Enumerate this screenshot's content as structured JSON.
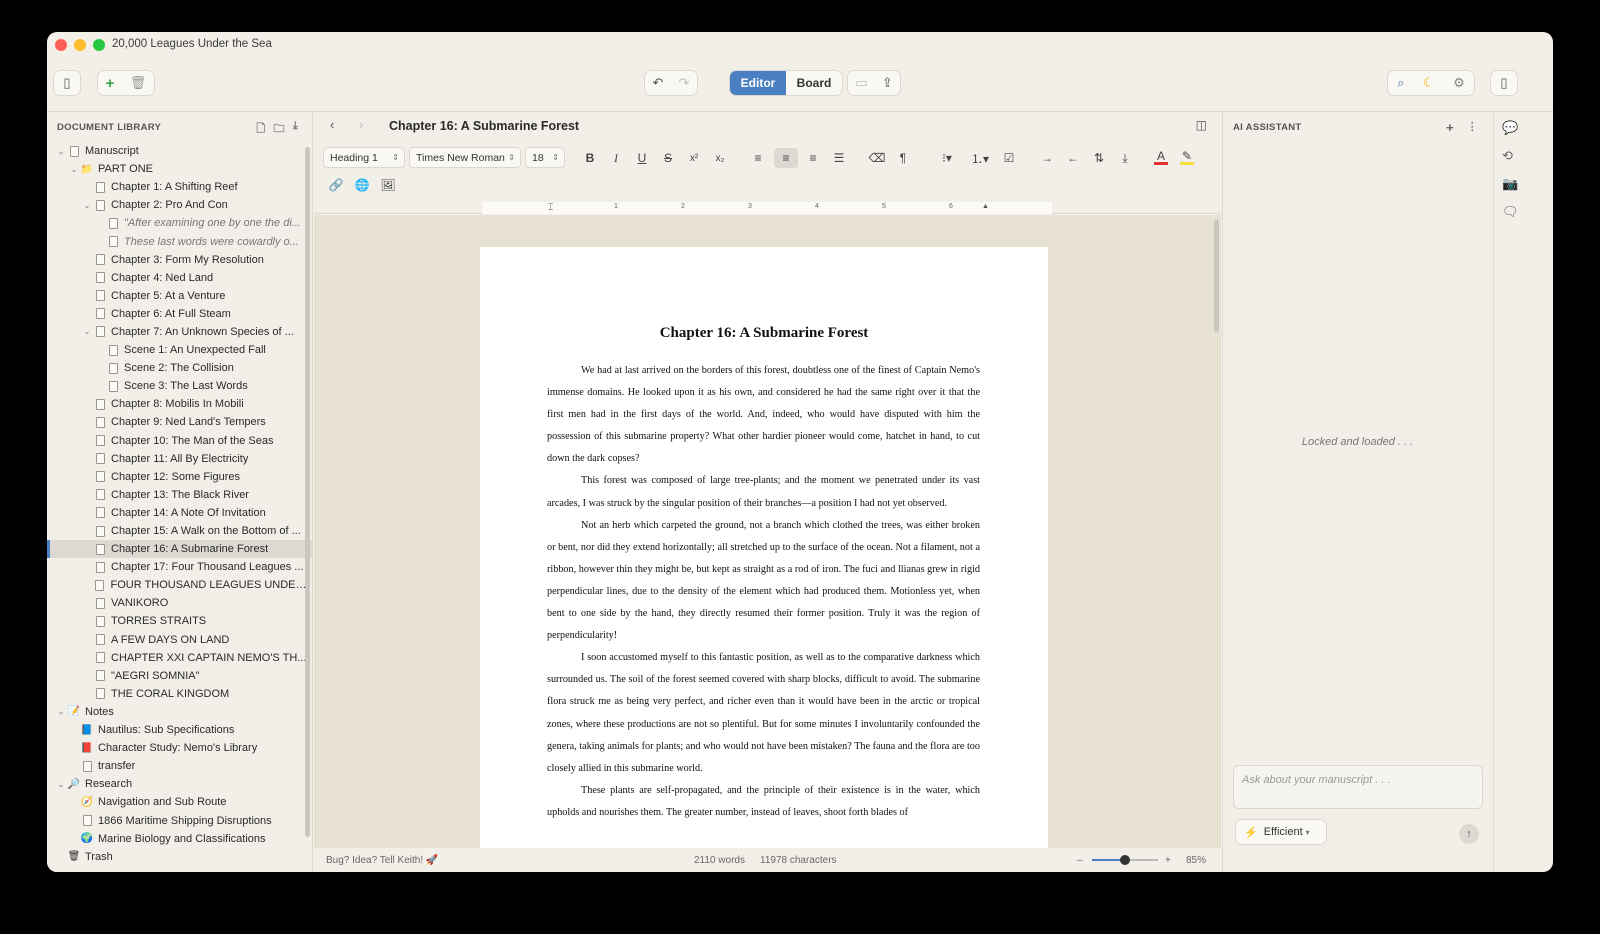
{
  "window": {
    "title": "20,000 Leagues Under the Sea"
  },
  "toolbar": {
    "view_toggle": {
      "editor": "Editor",
      "board": "Board",
      "active": "Editor"
    }
  },
  "sidebar": {
    "header": "DOCUMENT LIBRARY",
    "tree": [
      {
        "label": "Manuscript",
        "level": 0,
        "expanded": true,
        "icon": "document-icon"
      },
      {
        "label": "PART ONE",
        "level": 1,
        "expanded": true,
        "icon": "folder-icon"
      },
      {
        "label": "Chapter 1: A Shifting Reef",
        "level": 2,
        "icon": "document-icon"
      },
      {
        "label": "Chapter 2: Pro And Con",
        "level": 2,
        "expanded": true,
        "icon": "document-icon"
      },
      {
        "label": "\"After examining one by one the di...",
        "level": 3,
        "italic": true,
        "icon": "document-icon"
      },
      {
        "label": "These last words were cowardly o...",
        "level": 3,
        "italic": true,
        "icon": "document-icon"
      },
      {
        "label": "Chapter 3: Form My Resolution",
        "level": 2,
        "icon": "document-icon"
      },
      {
        "label": "Chapter 4: Ned Land",
        "level": 2,
        "icon": "document-icon"
      },
      {
        "label": "Chapter 5: At a Venture",
        "level": 2,
        "icon": "document-icon"
      },
      {
        "label": "Chapter 6: At Full Steam",
        "level": 2,
        "icon": "document-icon"
      },
      {
        "label": "Chapter 7: An Unknown Species of ...",
        "level": 2,
        "expanded": true,
        "icon": "document-icon"
      },
      {
        "label": "Scene 1: An Unexpected Fall",
        "level": 3,
        "icon": "document-icon"
      },
      {
        "label": "Scene 2: The Collision",
        "level": 3,
        "icon": "document-icon"
      },
      {
        "label": "Scene 3: The Last Words",
        "level": 3,
        "icon": "document-icon"
      },
      {
        "label": "Chapter 8: Mobilis In Mobili",
        "level": 2,
        "icon": "document-icon"
      },
      {
        "label": "Chapter 9: Ned Land's Tempers",
        "level": 2,
        "icon": "document-icon"
      },
      {
        "label": "Chapter 10: The Man of the Seas",
        "level": 2,
        "icon": "document-icon"
      },
      {
        "label": "Chapter 11: All By Electricity",
        "level": 2,
        "icon": "document-icon"
      },
      {
        "label": "Chapter 12: Some Figures",
        "level": 2,
        "icon": "document-icon"
      },
      {
        "label": "Chapter 13: The Black River",
        "level": 2,
        "icon": "document-icon"
      },
      {
        "label": "Chapter 14: A Note Of Invitation",
        "level": 2,
        "icon": "document-icon"
      },
      {
        "label": "Chapter 15: A Walk on the Bottom of ...",
        "level": 2,
        "icon": "document-icon"
      },
      {
        "label": "Chapter 16: A Submarine Forest",
        "level": 2,
        "selected": true,
        "icon": "document-icon"
      },
      {
        "label": "Chapter 17: Four Thousand Leagues ...",
        "level": 2,
        "icon": "document-icon"
      },
      {
        "label": "FOUR THOUSAND LEAGUES UNDER ...",
        "level": 2,
        "icon": "document-icon"
      },
      {
        "label": "VANIKORO",
        "level": 2,
        "icon": "document-icon"
      },
      {
        "label": "TORRES STRAITS",
        "level": 2,
        "icon": "document-icon"
      },
      {
        "label": "A FEW DAYS ON LAND",
        "level": 2,
        "icon": "document-icon"
      },
      {
        "label": "CHAPTER XXI CAPTAIN NEMO'S TH...",
        "level": 2,
        "icon": "document-icon"
      },
      {
        "label": "\"AEGRI SOMNIA\"",
        "level": 2,
        "icon": "document-icon"
      },
      {
        "label": "THE CORAL KINGDOM",
        "level": 2,
        "icon": "document-icon"
      },
      {
        "label": "Notes",
        "level": 0,
        "expanded": true,
        "icon": "notes-icon"
      },
      {
        "label": "Nautilus: Sub Specifications",
        "level": 1,
        "icon": "blue-book-icon"
      },
      {
        "label": "Character Study: Nemo's Library",
        "level": 1,
        "icon": "red-book-icon"
      },
      {
        "label": "transfer",
        "level": 1,
        "icon": "document-icon"
      },
      {
        "label": "Research",
        "level": 0,
        "expanded": true,
        "icon": "magnifier-icon"
      },
      {
        "label": "Navigation and Sub Route",
        "level": 1,
        "icon": "compass-icon"
      },
      {
        "label": "1866 Maritime Shipping Disruptions",
        "level": 1,
        "icon": "document-icon"
      },
      {
        "label": "Marine Biology and Classifications",
        "level": 1,
        "icon": "globe-icon"
      },
      {
        "label": "Trash",
        "level": 0,
        "icon": "trash-icon"
      }
    ]
  },
  "editor": {
    "doc_title": "Chapter 16: A Submarine Forest",
    "format": {
      "style": "Heading 1",
      "font": "Times New Roman",
      "size": "18"
    },
    "ruler_marks": [
      "1",
      "2",
      "3",
      "4",
      "5",
      "6"
    ],
    "page": {
      "heading": "Chapter 16: A Submarine Forest",
      "paragraphs": [
        "We had at last arrived on the borders of this forest, doubtless one of the finest of Captain Nemo's immense domains. He looked upon it as his own, and considered he had the same right over it that the first men had in the first days of the world. And, indeed, who would have disputed with him the possession of this submarine property? What other hardier pioneer would come, hatchet in hand, to cut down the dark copses?",
        "This forest was composed of large tree-plants; and the moment we penetrated under its vast arcades, I was struck by the singular position of their branches—a position I had not yet observed.",
        "Not an herb which carpeted the ground, not a branch which clothed the trees, was either broken or bent, nor did they extend horizontally; all stretched up to the surface of the ocean. Not a filament, not a ribbon, however thin they might be, but kept as straight as a rod of iron. The fuci and llianas grew in rigid perpendicular lines, due to the density of the element which had produced them. Motionless yet, when bent to one side by the hand, they directly resumed their former position. Truly it was the region of perpendicularity!",
        "I soon accustomed myself to this fantastic position, as well as to the comparative darkness which surrounded us. The soil of the forest seemed covered with sharp blocks, difficult to avoid. The submarine flora struck me as being very perfect, and richer even than it would have been in the arctic or tropical zones, where these productions are not so plentiful. But for some minutes I involuntarily confounded the genera, taking animals for plants; and who would not have been mistaken? The fauna and the flora are too closely allied in this submarine world.",
        "These plants are self-propagated, and the principle of their existence is in the water, which upholds and nourishes them. The greater number, instead of leaves, shoot forth blades of"
      ]
    },
    "status": {
      "feedback": "Bug? Idea? Tell Keith! 🚀",
      "words": "2110 words",
      "characters": "11978 characters",
      "zoom": "85%",
      "zoom_value": 0.5
    }
  },
  "ai_panel": {
    "header": "AI ASSISTANT",
    "status_text": "Locked and loaded . . .",
    "input_placeholder": "Ask about your manuscript . . .",
    "mode": "Efficient"
  },
  "colors": {
    "accent": "#4a7fc1",
    "text_color_swatch": "#e03030",
    "highlight_swatch": "#f5e13a"
  }
}
